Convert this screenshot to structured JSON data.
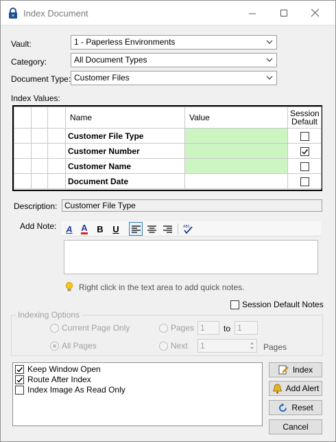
{
  "window": {
    "title": "Index Document"
  },
  "form": {
    "vault_label": "Vault:",
    "vault_value": "1 - Paperless Environments",
    "category_label": "Category:",
    "category_value": "All Document Types",
    "doctype_label": "Document Type:",
    "doctype_value": "Customer Files",
    "index_values_label": "Index Values:"
  },
  "grid": {
    "headers": {
      "name": "Name",
      "value": "Value",
      "session_default_1": "Session",
      "session_default_2": "Default"
    },
    "rows": [
      {
        "name": "Customer File Type",
        "value": "",
        "session_default": false,
        "required": true
      },
      {
        "name": "Customer Number",
        "value": "",
        "session_default": true,
        "required": true
      },
      {
        "name": "Customer Name",
        "value": "",
        "session_default": false,
        "required": true
      },
      {
        "name": "Document Date",
        "value": "",
        "session_default": false,
        "required": false
      }
    ]
  },
  "description": {
    "label": "Description:",
    "value": "Customer File Type"
  },
  "note": {
    "label": "Add Note:",
    "hint": "Right click in the text area to add quick notes.",
    "toolbar": {
      "bold": "B",
      "underline": "U",
      "font_color": "A",
      "font_style": "A"
    }
  },
  "session_default_notes": {
    "label": "Session Default Notes",
    "checked": false
  },
  "indexing_options": {
    "title": "Indexing Options",
    "current_page_only": "Current Page Only",
    "all_pages": "All Pages",
    "pages": "Pages",
    "pages_from": "1",
    "to": "to",
    "pages_to": "1",
    "next": "Next",
    "next_value": "1",
    "pages_suffix": "Pages"
  },
  "options": [
    {
      "label": "Keep Window Open",
      "checked": true
    },
    {
      "label": "Route After Index",
      "checked": true
    },
    {
      "label": "Index Image As Read Only",
      "checked": false
    }
  ],
  "buttons": {
    "index": "Index",
    "add_alert": "Add Alert",
    "reset": "Reset",
    "cancel": "Cancel"
  },
  "colors": {
    "required_field": "#ccf5c2",
    "accent": "#3c7fb1"
  }
}
